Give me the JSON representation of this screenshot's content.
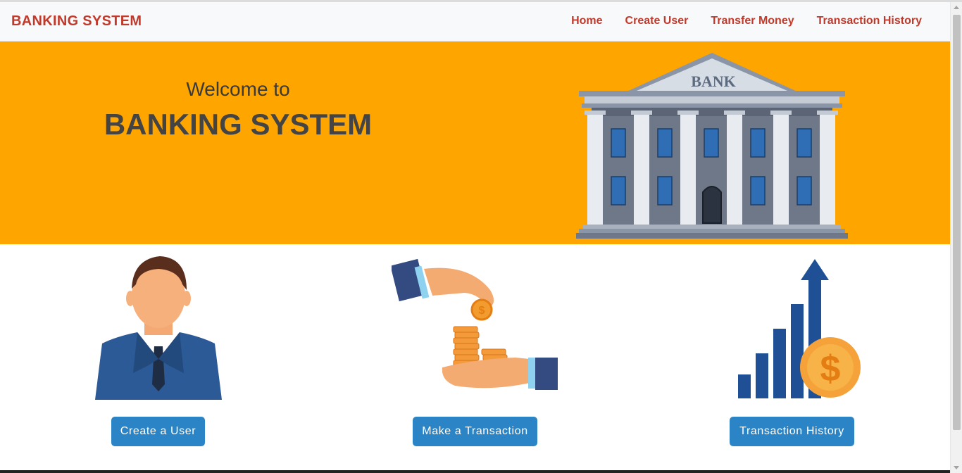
{
  "navbar": {
    "brand": "BANKING SYSTEM",
    "links": [
      "Home",
      "Create User",
      "Transfer Money",
      "Transaction History"
    ]
  },
  "hero": {
    "welcome": "Welcome to",
    "title": "BANKING SYSTEM",
    "bank_sign": "BANK"
  },
  "cards": [
    {
      "button": "Create a User",
      "icon": "businessman-icon"
    },
    {
      "button": "Make a Transaction",
      "icon": "coins-hands-icon"
    },
    {
      "button": "Transaction History",
      "icon": "growth-chart-icon"
    }
  ],
  "colors": {
    "brand": "#c0392b",
    "hero_bg": "#ffa500",
    "button_bg": "#2a84c6"
  }
}
